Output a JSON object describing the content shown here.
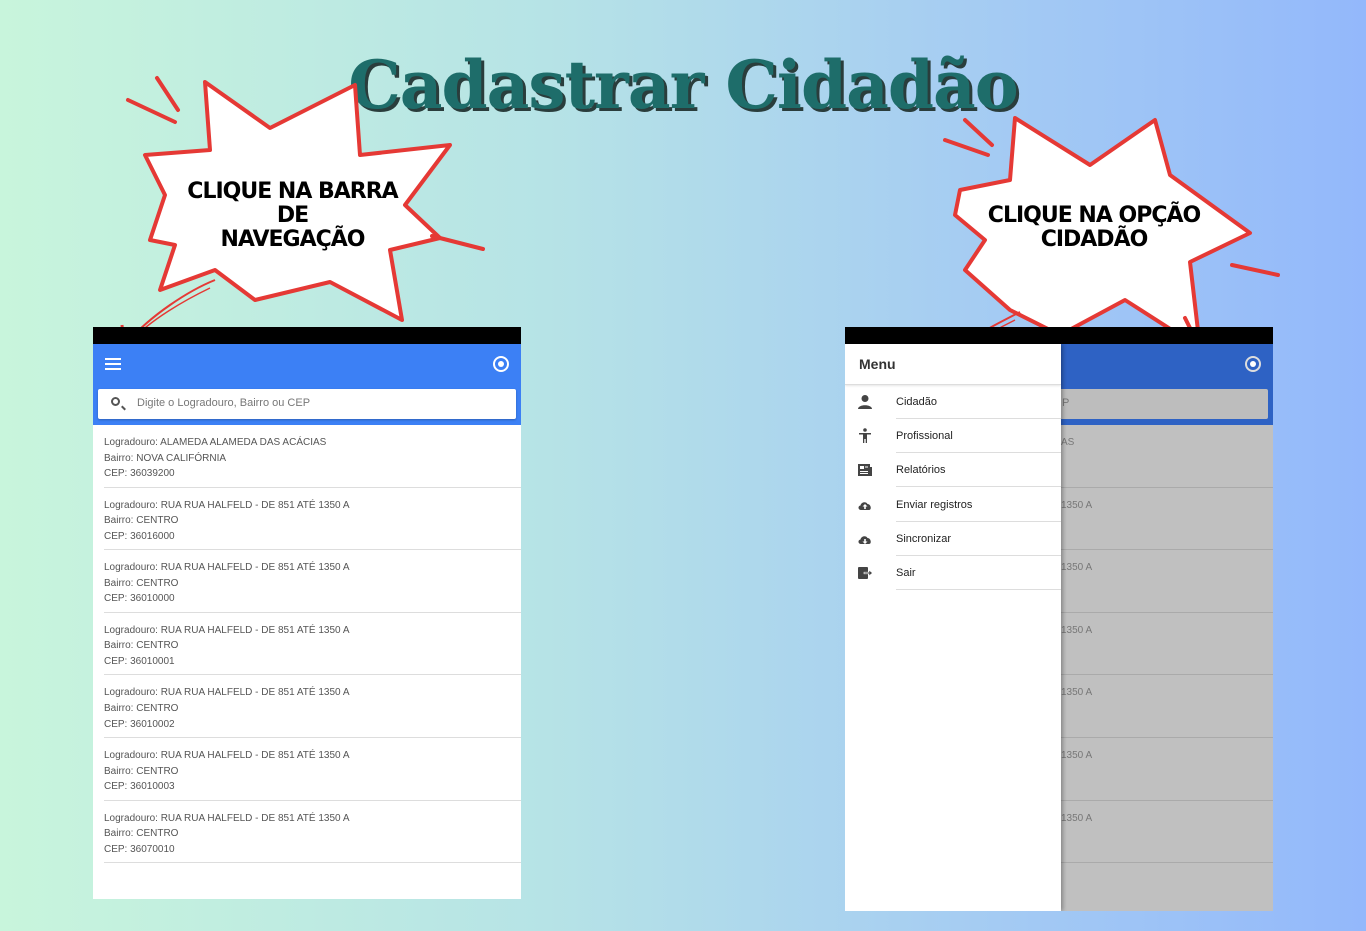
{
  "title": "Cadastrar Cidadão",
  "callouts": {
    "left": [
      "CLIQUE NA BARRA DE",
      "NAVEGAÇÃO"
    ],
    "right": [
      "CLIQUE NA OPÇÃO",
      "CIDADÃO"
    ]
  },
  "search": {
    "placeholder": "Digite o Logradouro, Bairro ou CEP"
  },
  "addresses": [
    {
      "logradouro": "Logradouro: ALAMEDA ALAMEDA DAS ACÁCIAS",
      "bairro": "Bairro: NOVA CALIFÓRNIA",
      "cep": "CEP: 36039200",
      "right_fragment": "AS"
    },
    {
      "logradouro": "Logradouro: RUA RUA HALFELD - DE 851 ATÉ 1350 A",
      "bairro": "Bairro: CENTRO",
      "cep": "CEP: 36016000",
      "right_fragment": "1350 A"
    },
    {
      "logradouro": "Logradouro: RUA RUA HALFELD - DE 851 ATÉ 1350 A",
      "bairro": "Bairro: CENTRO",
      "cep": "CEP: 36010000",
      "right_fragment": "1350 A"
    },
    {
      "logradouro": "Logradouro: RUA RUA HALFELD - DE 851 ATÉ 1350 A",
      "bairro": "Bairro: CENTRO",
      "cep": "CEP: 36010001",
      "right_fragment": "1350 A"
    },
    {
      "logradouro": "Logradouro: RUA RUA HALFELD - DE 851 ATÉ 1350 A",
      "bairro": "Bairro: CENTRO",
      "cep": "CEP: 36010002",
      "right_fragment": "1350 A"
    },
    {
      "logradouro": "Logradouro: RUA RUA HALFELD - DE 851 ATÉ 1350 A",
      "bairro": "Bairro: CENTRO",
      "cep": "CEP: 36010003",
      "right_fragment": "1350 A"
    },
    {
      "logradouro": "Logradouro: RUA RUA HALFELD - DE 851 ATÉ 1350 A",
      "bairro": "Bairro: CENTRO",
      "cep": "CEP: 36070010",
      "right_fragment": "1350 A"
    }
  ],
  "drawer": {
    "title": "Menu",
    "items": [
      {
        "label": "Cidadão",
        "icon": "person-icon"
      },
      {
        "label": "Profissional",
        "icon": "accessibility-icon"
      },
      {
        "label": "Relatórios",
        "icon": "newspaper-icon"
      },
      {
        "label": "Enviar registros",
        "icon": "cloud-upload-icon"
      },
      {
        "label": "Sincronizar",
        "icon": "cloud-download-icon"
      },
      {
        "label": "Sair",
        "icon": "exit-icon"
      }
    ]
  },
  "colors": {
    "appbar": "#3c80f5",
    "title": "#1e6d6a",
    "callout_outline": "#e53935"
  }
}
